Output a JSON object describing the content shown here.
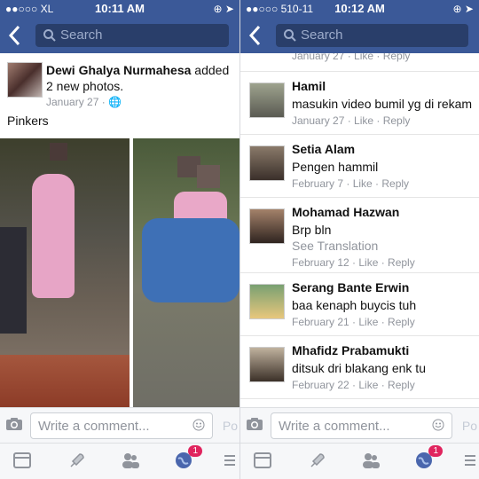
{
  "left": {
    "status": {
      "carrier": "●●○○○ XL",
      "time": "10:11 AM",
      "right": "⊕ ➤"
    },
    "search": {
      "placeholder": "Search"
    },
    "post": {
      "author": "Dewi Ghalya Nurmahesa",
      "action": "added 2 new photos.",
      "date": "January 27",
      "caption": "Pinkers"
    },
    "comment_bar": {
      "placeholder": "Write a comment...",
      "post_button": "Po"
    },
    "tab_badge": "1"
  },
  "right": {
    "status": {
      "carrier": "●●○○○ 510-11",
      "time": "10:12 AM",
      "right": "⊕ ➤"
    },
    "search": {
      "placeholder": "Search"
    },
    "top_meta": "January 27 · Like · Reply",
    "comments": [
      {
        "name": "Hamil",
        "text": "masukin video bumil yg di rekam",
        "meta": "January 27 · Like · Reply"
      },
      {
        "name": "Setia Alam",
        "text": "Pengen hammil",
        "meta": "February 7 · Like · Reply"
      },
      {
        "name": "Mohamad Hazwan",
        "text": "Brp bln",
        "translation": "See Translation",
        "meta": "February 12 · Like · Reply"
      },
      {
        "name": "Serang Bante Erwin",
        "text": "baa kenaph buycis tuh",
        "meta": "February 21 · Like · Reply"
      },
      {
        "name": "Mhafidz Prabamukti",
        "text": "ditsuk dri blakang enk tu",
        "meta": "February 22 · Like · Reply"
      }
    ],
    "comment_bar": {
      "placeholder": "Write a comment...",
      "post_button": "Po"
    },
    "tab_badge": "1"
  }
}
